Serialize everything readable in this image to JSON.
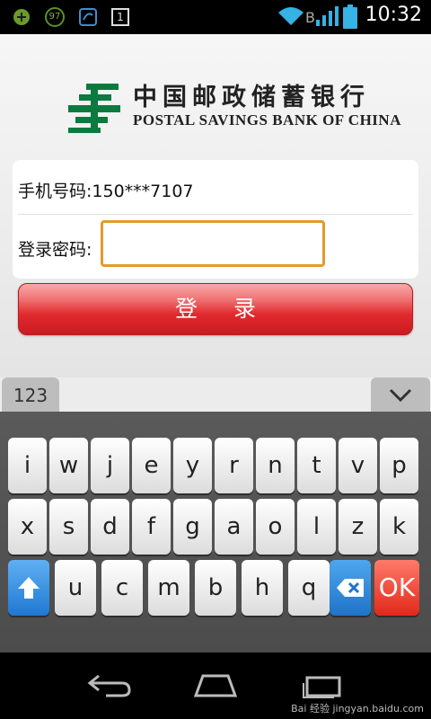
{
  "status_bar": {
    "time": "10:32",
    "notification_badge": "97",
    "window_count": "1",
    "network_letter": "B"
  },
  "bank": {
    "name_cn": "中国邮政储蓄银行",
    "name_en": "POSTAL SAVINGS BANK OF CHINA",
    "brand_color": "#0b7a3e"
  },
  "login_form": {
    "phone_label": "手机号码:",
    "phone_value": "150***7107",
    "password_label": "登录密码:",
    "password_value": "",
    "submit_label": "登录"
  },
  "keyboard": {
    "numbers_tab": "123",
    "hide_icon": "chevron-down-icon",
    "rows": [
      [
        "i",
        "w",
        "j",
        "e",
        "y",
        "r",
        "n",
        "t",
        "v",
        "p"
      ],
      [
        "x",
        "s",
        "d",
        "f",
        "g",
        "a",
        "o",
        "l",
        "z",
        "k"
      ],
      [
        "u",
        "c",
        "m",
        "b",
        "h",
        "q"
      ]
    ],
    "shift_icon": "shift-arrow-icon",
    "backspace_icon": "backspace-icon",
    "ok_label": "OK"
  },
  "nav_bar": {
    "icons": [
      "back-icon",
      "home-icon",
      "recent-apps-icon"
    ]
  },
  "watermark": "Bai 经验 jingyan.baidu.com"
}
